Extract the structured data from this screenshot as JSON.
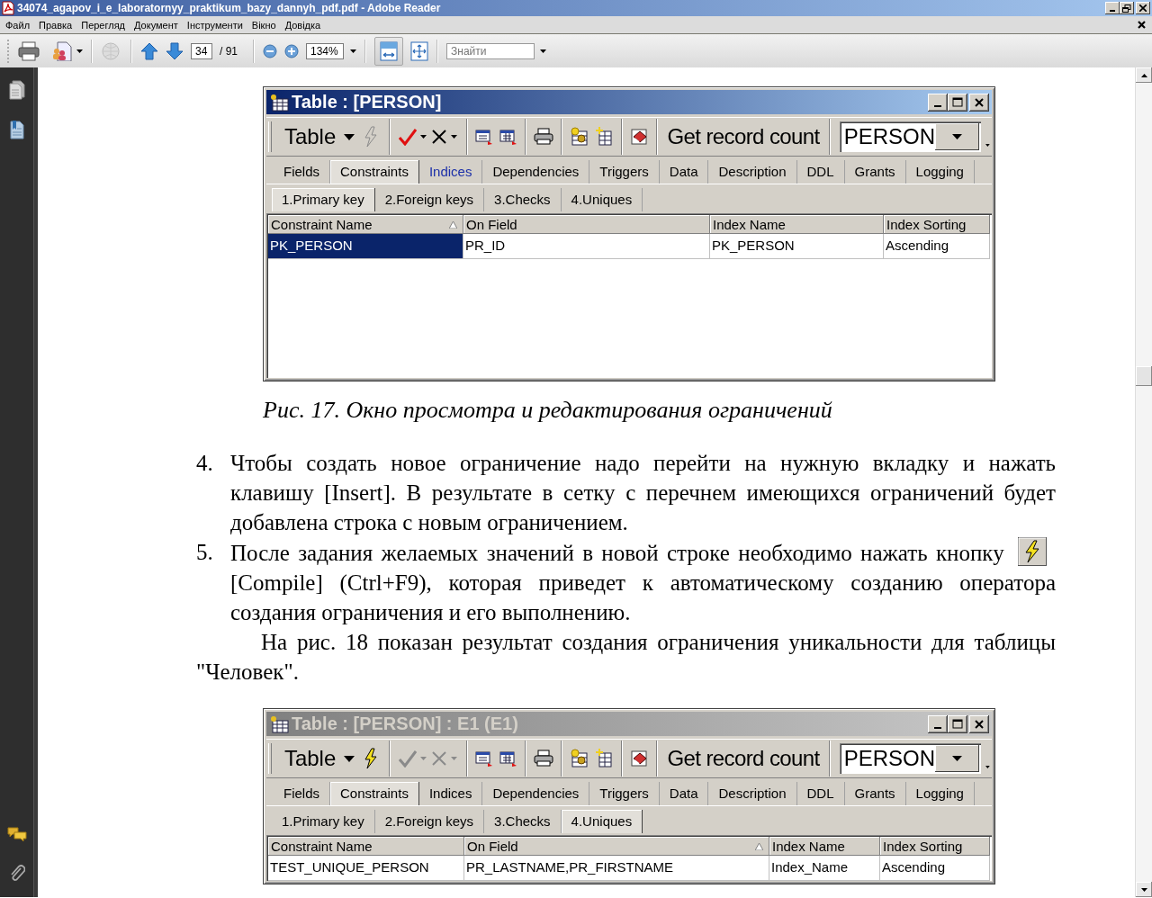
{
  "window": {
    "title": "34074_agapov_i_e_laboratornyy_praktikum_bazy_dannyh_pdf.pdf - Adobe Reader"
  },
  "menu": [
    {
      "label": "Файл"
    },
    {
      "label": "Правка"
    },
    {
      "label": "Перегляд"
    },
    {
      "label": "Документ"
    },
    {
      "label": "Інструменти"
    },
    {
      "label": "Вікно"
    },
    {
      "label": "Довідка"
    }
  ],
  "toolbar": {
    "page_number": "34",
    "page_count": "/ 91",
    "zoom": "134%",
    "fit_width_pressed": true,
    "search": {
      "placeholder": "Знайти"
    }
  },
  "document": {
    "blocks": [
      {
        "kind": "figure",
        "active": true,
        "title": "Table : [PERSON]",
        "table_menu": "Table",
        "compile_enabled": false,
        "commit_enabled": true,
        "record_count_button": "Get record count",
        "object": "PERSON",
        "tabs": [
          {
            "label": "Fields",
            "selected": false,
            "hovered": false
          },
          {
            "label": "Constraints",
            "selected": true,
            "hovered": false
          },
          {
            "label": "Indices",
            "selected": false,
            "hovered": true
          },
          {
            "label": "Dependencies",
            "selected": false,
            "hovered": false
          },
          {
            "label": "Triggers",
            "selected": false,
            "hovered": false
          },
          {
            "label": "Data",
            "selected": false,
            "hovered": false
          },
          {
            "label": "Description",
            "selected": false,
            "hovered": false
          },
          {
            "label": "DDL",
            "selected": false,
            "hovered": false
          },
          {
            "label": "Grants",
            "selected": false,
            "hovered": false
          },
          {
            "label": "Logging",
            "selected": false,
            "hovered": false
          }
        ],
        "subtabs": [
          {
            "label": "1.Primary key",
            "selected": true
          },
          {
            "label": "2.Foreign keys",
            "selected": false
          },
          {
            "label": "3.Checks",
            "selected": false
          },
          {
            "label": "4.Uniques",
            "selected": false
          }
        ],
        "columns": [
          {
            "label": "Constraint Name",
            "sorted": true
          },
          {
            "label": "On Field",
            "sorted": false
          },
          {
            "label": "Index Name",
            "sorted": false
          },
          {
            "label": "Index Sorting",
            "sorted": false
          }
        ],
        "rows": [
          {
            "selected": true,
            "cells": [
              "PK_PERSON",
              "PR_ID",
              "PK_PERSON",
              "Ascending"
            ]
          }
        ]
      },
      {
        "kind": "caption",
        "text": "Рис. 17. Окно просмотра и редактирования ограничений"
      },
      {
        "kind": "list_item",
        "number": "4.",
        "text": "Чтобы создать новое ограничение надо перейти на нужную вкладку и нажать клавишу [Insert]. В результате в сетку с перечнем имеющихся ограничений будет добавлена строка с новым ограничением."
      },
      {
        "kind": "list_item",
        "number": "5.",
        "text": "После задания желаемых значений в новой строке необходимо нажать кнопку",
        "text_after_icon": "[Compile] (Ctrl+F9), которая приведет к автоматическому созданию оператора создания ограничения и его выполнению."
      },
      {
        "kind": "paragraph",
        "text": "На рис. 18 показан результат создания ограничения уникальности для таблицы \"Человек\"."
      },
      {
        "kind": "figure",
        "active": false,
        "title": "Table : [PERSON] : E1 (E1)",
        "table_menu": "Table",
        "compile_enabled": true,
        "commit_enabled": false,
        "record_count_button": "Get record count",
        "object": "PERSON",
        "tabs": [
          {
            "label": "Fields",
            "selected": false,
            "hovered": false
          },
          {
            "label": "Constraints",
            "selected": true,
            "hovered": false
          },
          {
            "label": "Indices",
            "selected": false,
            "hovered": false
          },
          {
            "label": "Dependencies",
            "selected": false,
            "hovered": false
          },
          {
            "label": "Triggers",
            "selected": false,
            "hovered": false
          },
          {
            "label": "Data",
            "selected": false,
            "hovered": false
          },
          {
            "label": "Description",
            "selected": false,
            "hovered": false
          },
          {
            "label": "DDL",
            "selected": false,
            "hovered": false
          },
          {
            "label": "Grants",
            "selected": false,
            "hovered": false
          },
          {
            "label": "Logging",
            "selected": false,
            "hovered": false
          }
        ],
        "subtabs": [
          {
            "label": "1.Primary key",
            "selected": false
          },
          {
            "label": "2.Foreign keys",
            "selected": false
          },
          {
            "label": "3.Checks",
            "selected": false
          },
          {
            "label": "4.Uniques",
            "selected": true
          }
        ],
        "columns": [
          {
            "label": "Constraint Name",
            "sorted": false
          },
          {
            "label": "On Field",
            "sorted": true
          },
          {
            "label": "Index Name",
            "sorted": false
          },
          {
            "label": "Index Sorting",
            "sorted": false
          }
        ],
        "rows": [
          {
            "selected": false,
            "cells": [
              "TEST_UNIQUE_PERSON",
              "PR_LASTNAME,PR_FIRSTNAME",
              "Index_Name",
              "Ascending"
            ]
          }
        ]
      }
    ]
  }
}
